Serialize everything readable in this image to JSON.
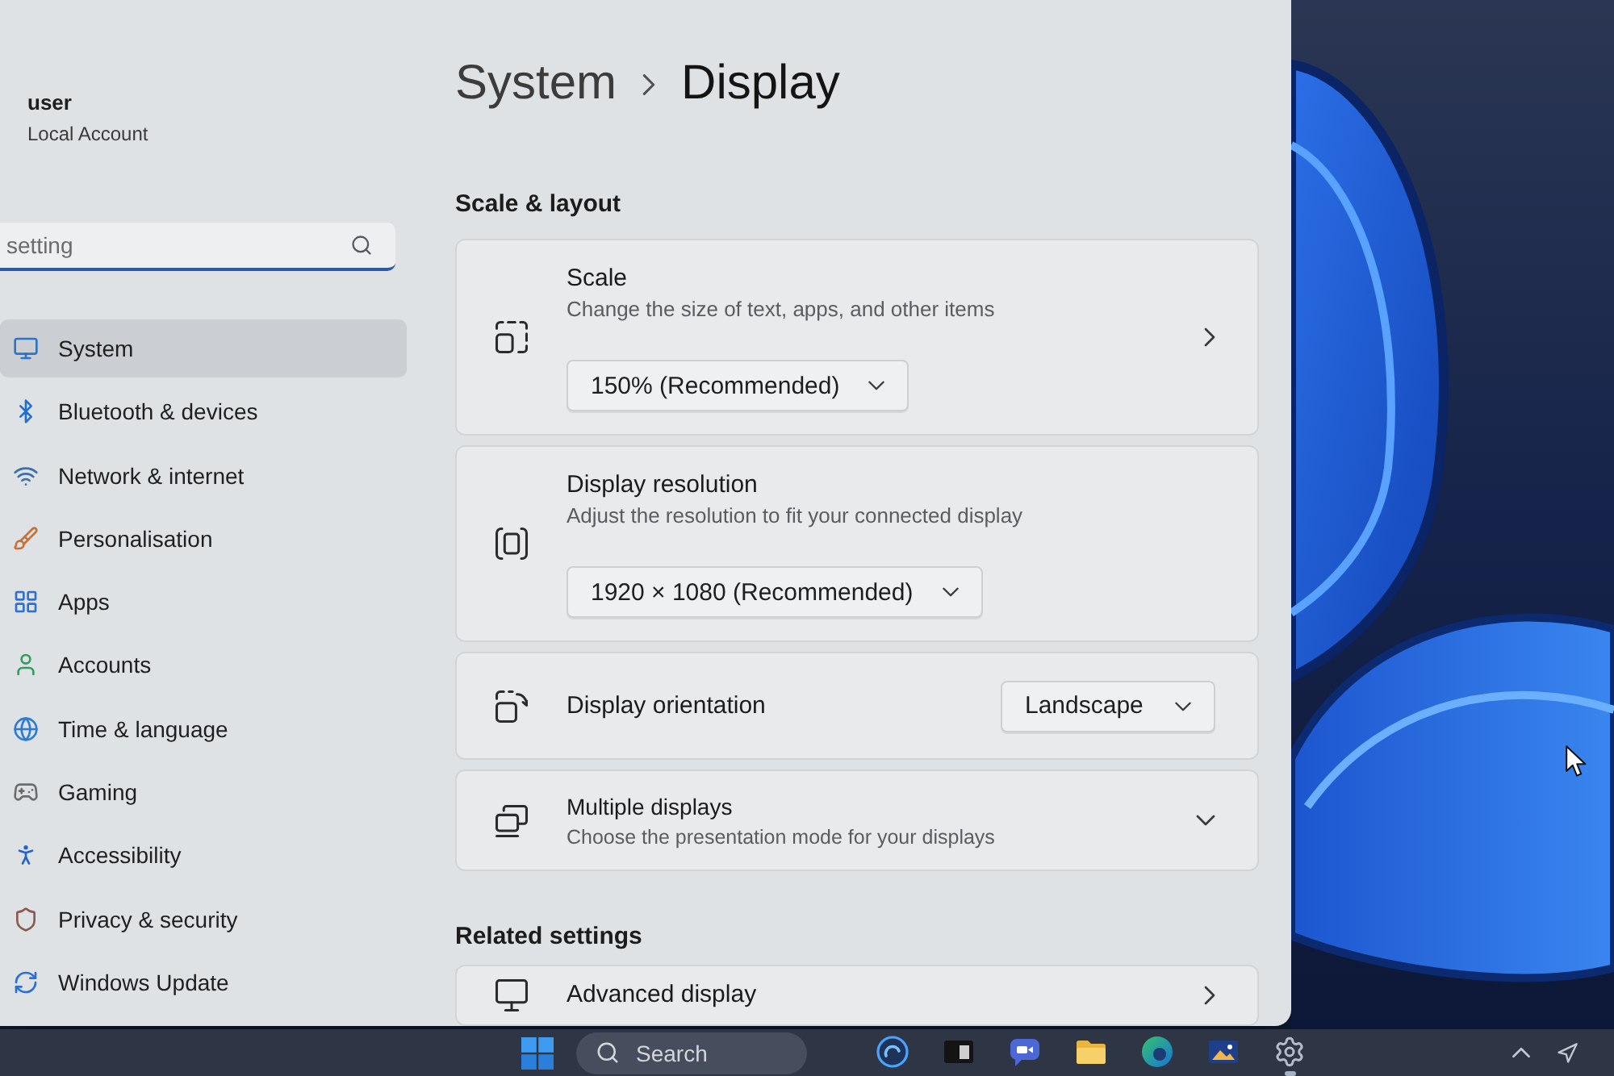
{
  "sidebar": {
    "account": {
      "name": "user",
      "type": "Local Account"
    },
    "search": {
      "placeholder": "setting"
    },
    "items": [
      {
        "label": "System",
        "selected": true
      },
      {
        "label": "Bluetooth & devices",
        "selected": false
      },
      {
        "label": "Network & internet",
        "selected": false
      },
      {
        "label": "Personalisation",
        "selected": false
      },
      {
        "label": "Apps",
        "selected": false
      },
      {
        "label": "Accounts",
        "selected": false
      },
      {
        "label": "Time & language",
        "selected": false
      },
      {
        "label": "Gaming",
        "selected": false
      },
      {
        "label": "Accessibility",
        "selected": false
      },
      {
        "label": "Privacy & security",
        "selected": false
      },
      {
        "label": "Windows Update",
        "selected": false
      }
    ]
  },
  "breadcrumb": {
    "parent": "System",
    "current": "Display"
  },
  "sections": [
    {
      "heading": "Scale & layout",
      "cards": [
        {
          "kind": "stacked",
          "title": "Scale",
          "description": "Change the size of text, apps, and other items",
          "value": "150% (Recommended)",
          "navigates": true
        },
        {
          "kind": "stacked",
          "title": "Display resolution",
          "description": "Adjust the resolution to fit your connected display",
          "value": "1920 × 1080 (Recommended)",
          "navigates": false
        },
        {
          "kind": "inline",
          "title": "Display orientation",
          "value": "Landscape"
        },
        {
          "kind": "expander",
          "title": "Multiple displays",
          "description": "Choose the presentation mode for your displays",
          "expanded": false
        }
      ]
    },
    {
      "heading": "Related settings",
      "cards": [
        {
          "kind": "link",
          "title": "Advanced display"
        }
      ]
    }
  ],
  "taskbar": {
    "search": {
      "label": "Search"
    },
    "apps": [
      {
        "running": false
      },
      {
        "running": false
      },
      {
        "running": false
      },
      {
        "running": false
      },
      {
        "running": false
      },
      {
        "running": false
      },
      {
        "running": true
      }
    ]
  }
}
